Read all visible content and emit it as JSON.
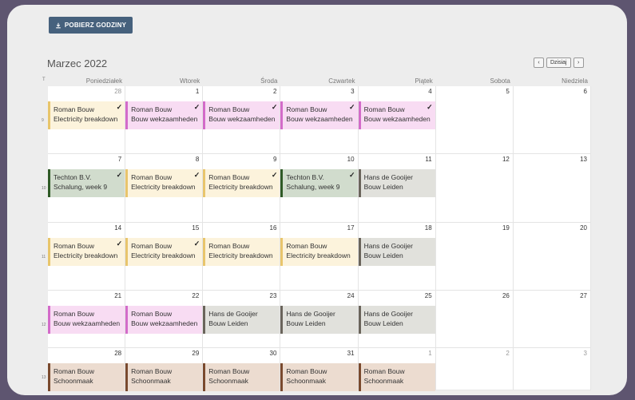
{
  "download_button": {
    "label": "POBIERZ GODZINY"
  },
  "calendar": {
    "title": "Marzec 2022",
    "nav": {
      "prev": "‹",
      "today": "Dzisiaj",
      "next": "›"
    },
    "week_col_header": "T",
    "weekdays": [
      "Poniedziałek",
      "Wtorek",
      "Środa",
      "Czwartek",
      "Piątek",
      "Sobota",
      "Niedziela"
    ],
    "weeks": [
      {
        "week_number": "9",
        "days": [
          {
            "num": "28",
            "out": true,
            "event": {
              "line1": "Roman Bouw",
              "line2": "Electricity breakdown",
              "color": "yellow",
              "checked": true
            }
          },
          {
            "num": "1",
            "out": false,
            "event": {
              "line1": "Roman Bouw",
              "line2": "Bouw wekzaamheden",
              "color": "pink",
              "checked": true
            }
          },
          {
            "num": "2",
            "out": false,
            "event": {
              "line1": "Roman Bouw",
              "line2": "Bouw wekzaamheden",
              "color": "pink",
              "checked": true
            }
          },
          {
            "num": "3",
            "out": false,
            "event": {
              "line1": "Roman Bouw",
              "line2": "Bouw wekzaamheden",
              "color": "pink",
              "checked": true
            }
          },
          {
            "num": "4",
            "out": false,
            "event": {
              "line1": "Roman Bouw",
              "line2": "Bouw wekzaamheden",
              "color": "pink",
              "checked": true
            }
          },
          {
            "num": "5",
            "out": false,
            "event": null
          },
          {
            "num": "6",
            "out": false,
            "event": null
          }
        ]
      },
      {
        "week_number": "10",
        "days": [
          {
            "num": "7",
            "out": false,
            "event": {
              "line1": "Techton B.V.",
              "line2": "Schalung, week 9",
              "color": "green",
              "checked": true
            }
          },
          {
            "num": "8",
            "out": false,
            "event": {
              "line1": "Roman Bouw",
              "line2": "Electricity breakdown",
              "color": "yellow",
              "checked": true
            }
          },
          {
            "num": "9",
            "out": false,
            "event": {
              "line1": "Roman Bouw",
              "line2": "Electricity breakdown",
              "color": "yellow",
              "checked": true
            }
          },
          {
            "num": "10",
            "out": false,
            "event": {
              "line1": "Techton B.V.",
              "line2": "Schalung, week 9",
              "color": "green",
              "checked": true
            }
          },
          {
            "num": "11",
            "out": false,
            "event": {
              "line1": "Hans de Gooijer",
              "line2": "Bouw Leiden",
              "color": "grey",
              "checked": false
            }
          },
          {
            "num": "12",
            "out": false,
            "event": null
          },
          {
            "num": "13",
            "out": false,
            "event": null
          }
        ]
      },
      {
        "week_number": "11",
        "days": [
          {
            "num": "14",
            "out": false,
            "event": {
              "line1": "Roman Bouw",
              "line2": "Electricity breakdown",
              "color": "yellow",
              "checked": true
            }
          },
          {
            "num": "15",
            "out": false,
            "event": {
              "line1": "Roman Bouw",
              "line2": "Electricity breakdown",
              "color": "yellow",
              "checked": true
            }
          },
          {
            "num": "16",
            "out": false,
            "event": {
              "line1": "Roman Bouw",
              "line2": "Electricity breakdown",
              "color": "yellow",
              "checked": false
            }
          },
          {
            "num": "17",
            "out": false,
            "event": {
              "line1": "Roman Bouw",
              "line2": "Electricity breakdown",
              "color": "yellow",
              "checked": false
            }
          },
          {
            "num": "18",
            "out": false,
            "event": {
              "line1": "Hans de Gooijer",
              "line2": "Bouw Leiden",
              "color": "grey",
              "checked": false
            }
          },
          {
            "num": "19",
            "out": false,
            "event": null
          },
          {
            "num": "20",
            "out": false,
            "event": null
          }
        ]
      },
      {
        "week_number": "12",
        "days": [
          {
            "num": "21",
            "out": false,
            "event": {
              "line1": "Roman Bouw",
              "line2": "Bouw wekzaamheden",
              "color": "pink",
              "checked": false
            }
          },
          {
            "num": "22",
            "out": false,
            "event": {
              "line1": "Roman Bouw",
              "line2": "Bouw wekzaamheden",
              "color": "pink",
              "checked": false
            }
          },
          {
            "num": "23",
            "out": false,
            "event": {
              "line1": "Hans de Gooijer",
              "line2": "Bouw Leiden",
              "color": "grey",
              "checked": false
            }
          },
          {
            "num": "24",
            "out": false,
            "event": {
              "line1": "Hans de Gooijer",
              "line2": "Bouw Leiden",
              "color": "grey",
              "checked": false
            }
          },
          {
            "num": "25",
            "out": false,
            "event": {
              "line1": "Hans de Gooijer",
              "line2": "Bouw Leiden",
              "color": "grey",
              "checked": false
            }
          },
          {
            "num": "26",
            "out": false,
            "event": null
          },
          {
            "num": "27",
            "out": false,
            "event": null
          }
        ]
      },
      {
        "week_number": "13",
        "days": [
          {
            "num": "28",
            "out": false,
            "event": {
              "line1": "Roman Bouw",
              "line2": "Schoonmaak",
              "color": "brown",
              "checked": false
            }
          },
          {
            "num": "29",
            "out": false,
            "event": {
              "line1": "Roman Bouw",
              "line2": "Schoonmaak",
              "color": "brown",
              "checked": false
            }
          },
          {
            "num": "30",
            "out": false,
            "event": {
              "line1": "Roman Bouw",
              "line2": "Schoonmaak",
              "color": "brown",
              "checked": false
            }
          },
          {
            "num": "31",
            "out": false,
            "event": {
              "line1": "Roman Bouw",
              "line2": "Schoonmaak",
              "color": "brown",
              "checked": false
            }
          },
          {
            "num": "1",
            "out": true,
            "event": {
              "line1": "Roman Bouw",
              "line2": "Schoonmaak",
              "color": "brown",
              "checked": false
            }
          },
          {
            "num": "2",
            "out": true,
            "event": null
          },
          {
            "num": "3",
            "out": true,
            "event": null
          }
        ]
      }
    ]
  }
}
